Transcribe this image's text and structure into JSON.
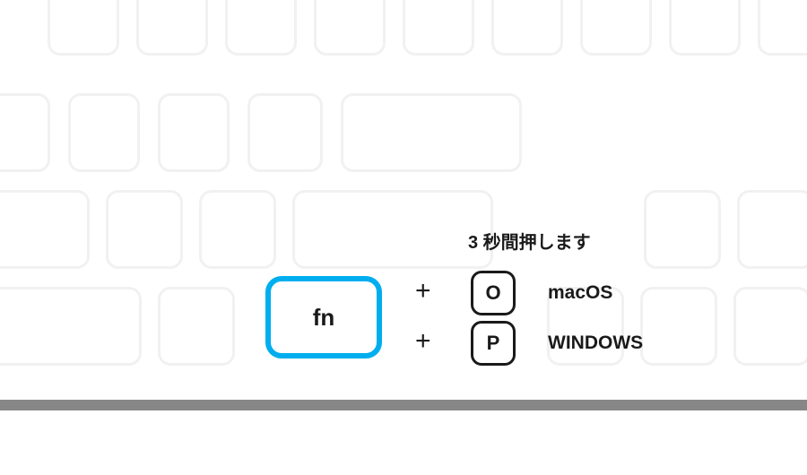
{
  "caption": "3 秒間押します",
  "primary_key_label": "fn",
  "plus_symbol": "+",
  "combos": [
    {
      "key": "O",
      "os": "macOS"
    },
    {
      "key": "P",
      "os": "WINDOWS"
    }
  ]
}
